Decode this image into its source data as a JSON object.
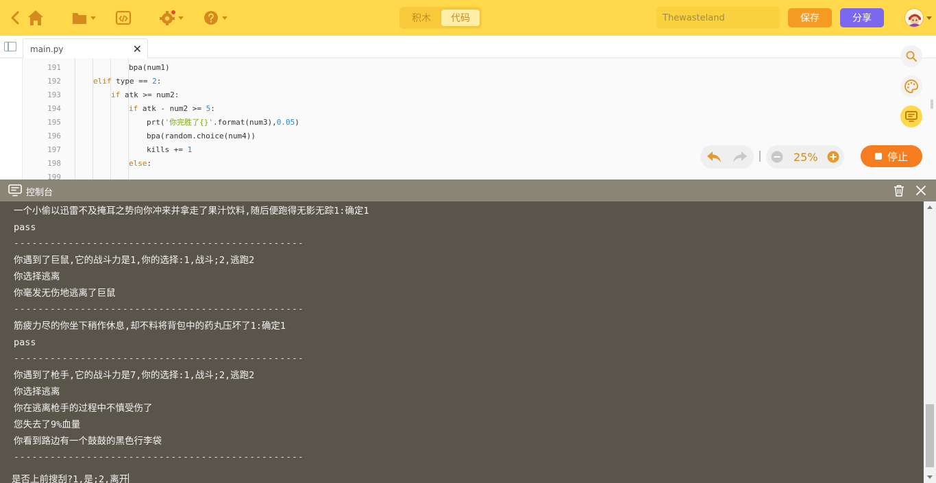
{
  "toolbar": {
    "mode_blocks": "积木",
    "mode_code": "代码",
    "project_name": "Thewasteland",
    "save_label": "保存",
    "share_label": "分享"
  },
  "editor": {
    "tab_name": "main.py",
    "zoom": "25%",
    "stop_label": "停止",
    "lines": [
      {
        "num": "191",
        "indent": 3,
        "html": "bpa(num1)"
      },
      {
        "num": "192",
        "indent": 1,
        "html": "<span class='kw'>elif</span> type == <span class='num'>2</span>:"
      },
      {
        "num": "193",
        "indent": 2,
        "html": "<span class='kw'>if</span> atk >= num2:"
      },
      {
        "num": "194",
        "indent": 3,
        "html": "<span class='kw'>if</span> atk - num2 >= <span class='num'>5</span>:"
      },
      {
        "num": "195",
        "indent": 4,
        "html": "prt(<span class='str'>'你完胜了{}'</span>.format(num3),<span class='num'>0.05</span>)"
      },
      {
        "num": "196",
        "indent": 4,
        "html": "bpa(random.choice(num4))"
      },
      {
        "num": "197",
        "indent": 4,
        "html": "kills += <span class='num'>1</span>"
      },
      {
        "num": "198",
        "indent": 3,
        "html": "<span class='kw'>else</span>:"
      },
      {
        "num": "199",
        "indent": 4,
        "html": ""
      }
    ]
  },
  "console": {
    "title": "控制台",
    "lines": [
      "一个小偷以迅雷不及掩耳之势向你冲来并拿走了果汁饮料,随后便跑得无影无踪1:确定1",
      "pass",
      "------------------------------------------------",
      "你遇到了巨鼠,它的战斗力是1,你的选择:1,战斗;2,逃跑2",
      "你选择逃离",
      "你毫发无伤地逃离了巨鼠",
      "------------------------------------------------",
      "筋疲力尽的你坐下稍作休息,却不料将背包中的药丸压坏了1:确定1",
      "pass",
      "------------------------------------------------",
      "你遇到了枪手,它的战斗力是7,你的选择:1,战斗;2,逃跑2",
      "你选择逃离",
      "你在逃离枪手的过程中不慎受伤了",
      "您失去了9%血量",
      "你看到路边有一个鼓鼓的黑色行李袋",
      "------------------------------------------------"
    ],
    "input": "是否上前搜刮?1,是;2,离开"
  },
  "colors": {
    "toolbar_bg": "#FFD84B",
    "accent_orange": "#F57C1F",
    "share_purple": "#7B68EE",
    "console_bg": "#59554A",
    "console_header": "#8A8574"
  },
  "icons": [
    "back-icon",
    "home-icon",
    "folder-icon",
    "code-icon",
    "gear-icon",
    "help-icon",
    "avatar",
    "sidebar-toggle-icon",
    "close-icon",
    "search-icon",
    "palette-icon",
    "monitor-icon",
    "undo-icon",
    "redo-icon",
    "zoom-out-icon",
    "zoom-in-icon",
    "stop-icon",
    "console-icon",
    "trash-icon",
    "console-close-icon"
  ]
}
